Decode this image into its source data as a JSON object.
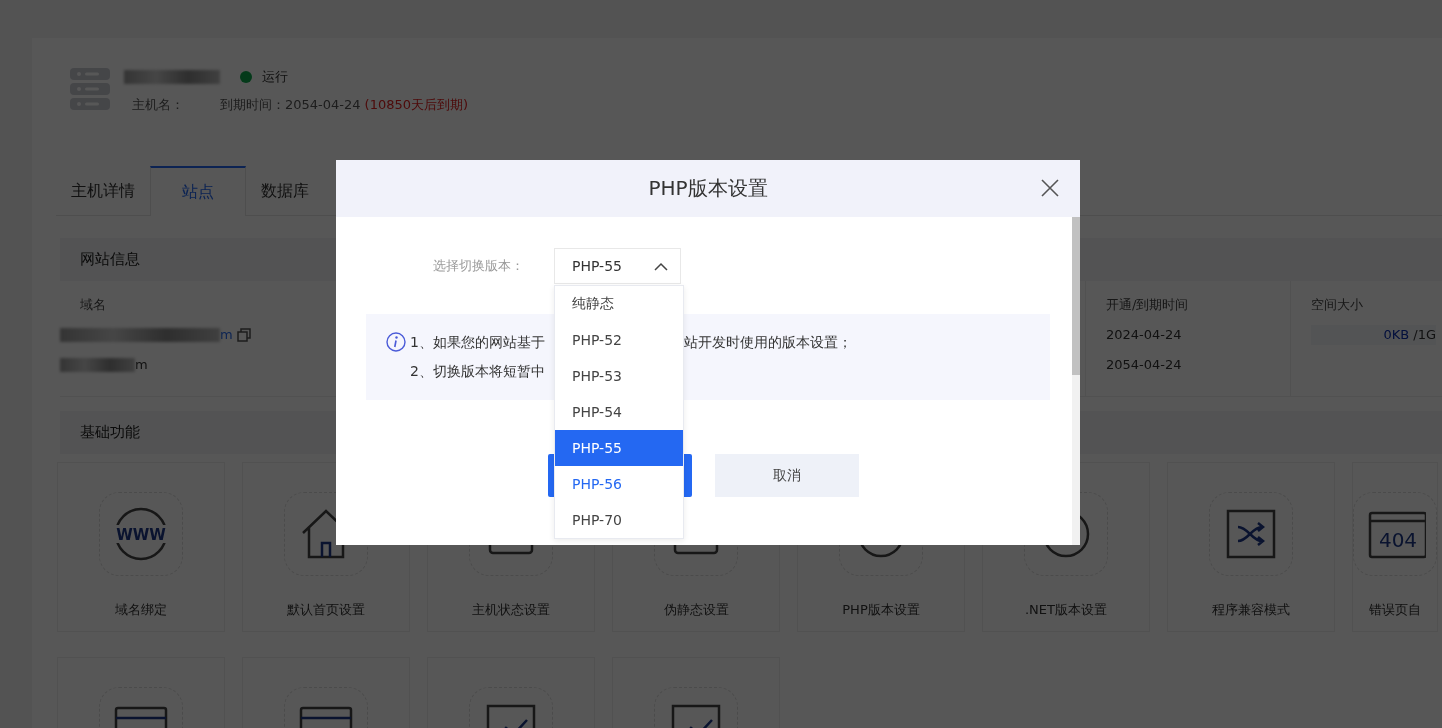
{
  "host": {
    "status": {
      "label": "运行",
      "running": true
    },
    "hostname_label": "主机名：",
    "expiry_label": "到期时间：2054-04-24",
    "expiry_note": "(10850天后到期)"
  },
  "tabs": [
    {
      "label": "主机详情",
      "selected": false
    },
    {
      "label": "站点",
      "selected": true
    },
    {
      "label": "数据库",
      "selected": false
    }
  ],
  "site_info": {
    "title": "网站信息",
    "columns": [
      "域名",
      "开通/到期时间",
      "空间大小"
    ],
    "domains": [
      {
        "text": "m",
        "copyable": true
      },
      {
        "text": "m",
        "copyable": false
      }
    ],
    "dates": [
      "2024-04-24",
      "2054-04-24"
    ],
    "space": {
      "used": "0KB",
      "total": "/1G",
      "level": 0
    }
  },
  "basic": {
    "title": "基础功能",
    "cards": [
      {
        "kind": "www",
        "icon_text": "WWW",
        "label": "域名绑定"
      },
      {
        "kind": "home",
        "label": "默认首页设置"
      },
      {
        "kind": "monitor",
        "label": "主机状态设置"
      },
      {
        "kind": "monitor",
        "label": "伪静态设置"
      },
      {
        "kind": "gauge",
        "label": "PHP版本设置"
      },
      {
        "kind": "gauge",
        "label": ".NET版本设置"
      },
      {
        "kind": "shuffle",
        "label": "程序兼容模式"
      },
      {
        "kind": "error",
        "icon_text": "404",
        "label": "错误页自"
      },
      {
        "kind": "redirect"
      },
      {
        "kind": "redirect"
      },
      {
        "kind": "chart"
      },
      {
        "kind": "chart"
      }
    ]
  },
  "modal": {
    "title": "PHP版本设置",
    "field_label": "选择切换版本：",
    "value": "PHP-55",
    "expanded": true,
    "options": [
      {
        "label": "纯静态",
        "selected": false,
        "hovered": false
      },
      {
        "label": "PHP-52",
        "selected": false,
        "hovered": false
      },
      {
        "label": "PHP-53",
        "selected": false,
        "hovered": false
      },
      {
        "label": "PHP-54",
        "selected": false,
        "hovered": false
      },
      {
        "label": "PHP-55",
        "selected": true,
        "hovered": false
      },
      {
        "label": "PHP-56",
        "selected": false,
        "hovered": true
      },
      {
        "label": "PHP-70",
        "selected": false,
        "hovered": false
      }
    ],
    "notes": [
      {
        "before": "1、如果您的网站基于",
        "after": "站开发时使用的版本设置；"
      },
      {
        "before": "2、切换版本将短暂中"
      }
    ],
    "cancel": "取消"
  }
}
